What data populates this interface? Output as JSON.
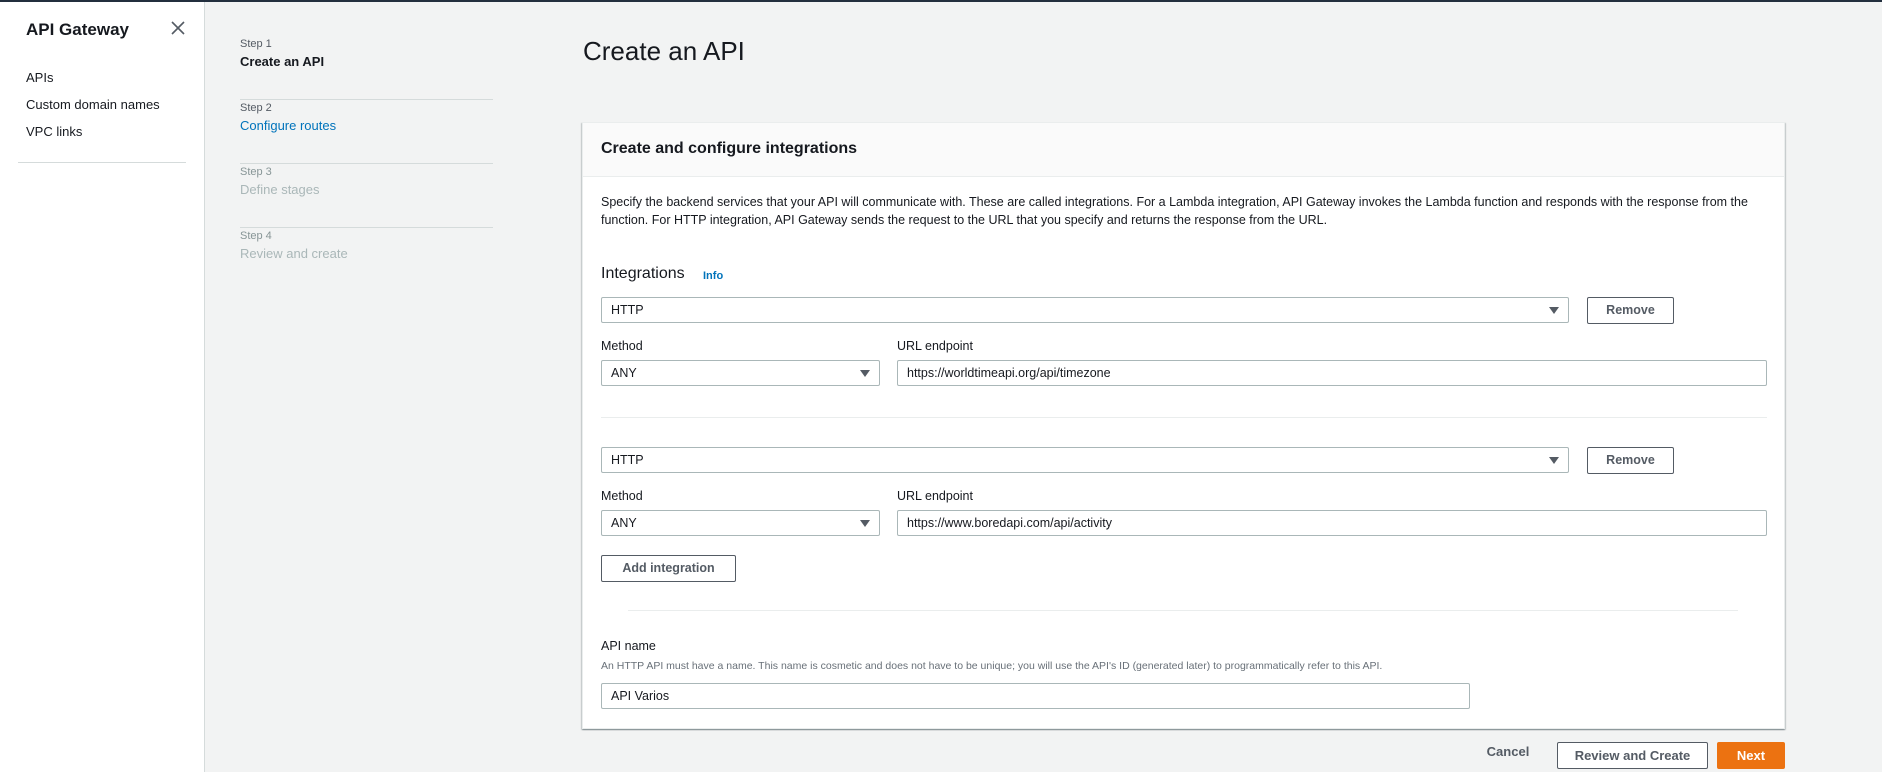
{
  "nav": {
    "title": "API Gateway",
    "items": [
      "APIs",
      "Custom domain names",
      "VPC links"
    ]
  },
  "steps": [
    {
      "num": "Step 1",
      "label": "Create an API"
    },
    {
      "num": "Step 2",
      "label": "Configure routes"
    },
    {
      "num": "Step 3",
      "label": "Define stages"
    },
    {
      "num": "Step 4",
      "label": "Review and create"
    }
  ],
  "page_title": "Create an API",
  "panel": {
    "title": "Create and configure integrations",
    "description": "Specify the backend services that your API will communicate with. These are called integrations. For a Lambda integration, API Gateway invokes the Lambda function and responds with the response from the function. For HTTP integration, API Gateway sends the request to the URL that you specify and returns the response from the URL.",
    "integrations_title": "Integrations",
    "info_label": "Info",
    "method_label": "Method",
    "url_label": "URL endpoint",
    "remove_label": "Remove",
    "integrations": [
      {
        "type": "HTTP",
        "method": "ANY",
        "url": "https://worldtimeapi.org/api/timezone"
      },
      {
        "type": "HTTP",
        "method": "ANY",
        "url": "https://www.boredapi.com/api/activity"
      }
    ],
    "add_integration_label": "Add integration",
    "api_name_label": "API name",
    "api_name_hint": "An HTTP API must have a name. This name is cosmetic and does not have to be unique; you will use the API's ID (generated later) to programmatically refer to this API.",
    "api_name_value": "API Varios"
  },
  "footer": {
    "cancel": "Cancel",
    "review": "Review and Create",
    "next": "Next"
  },
  "colors": {
    "accent": "#ec7211",
    "link": "#0073bb"
  }
}
